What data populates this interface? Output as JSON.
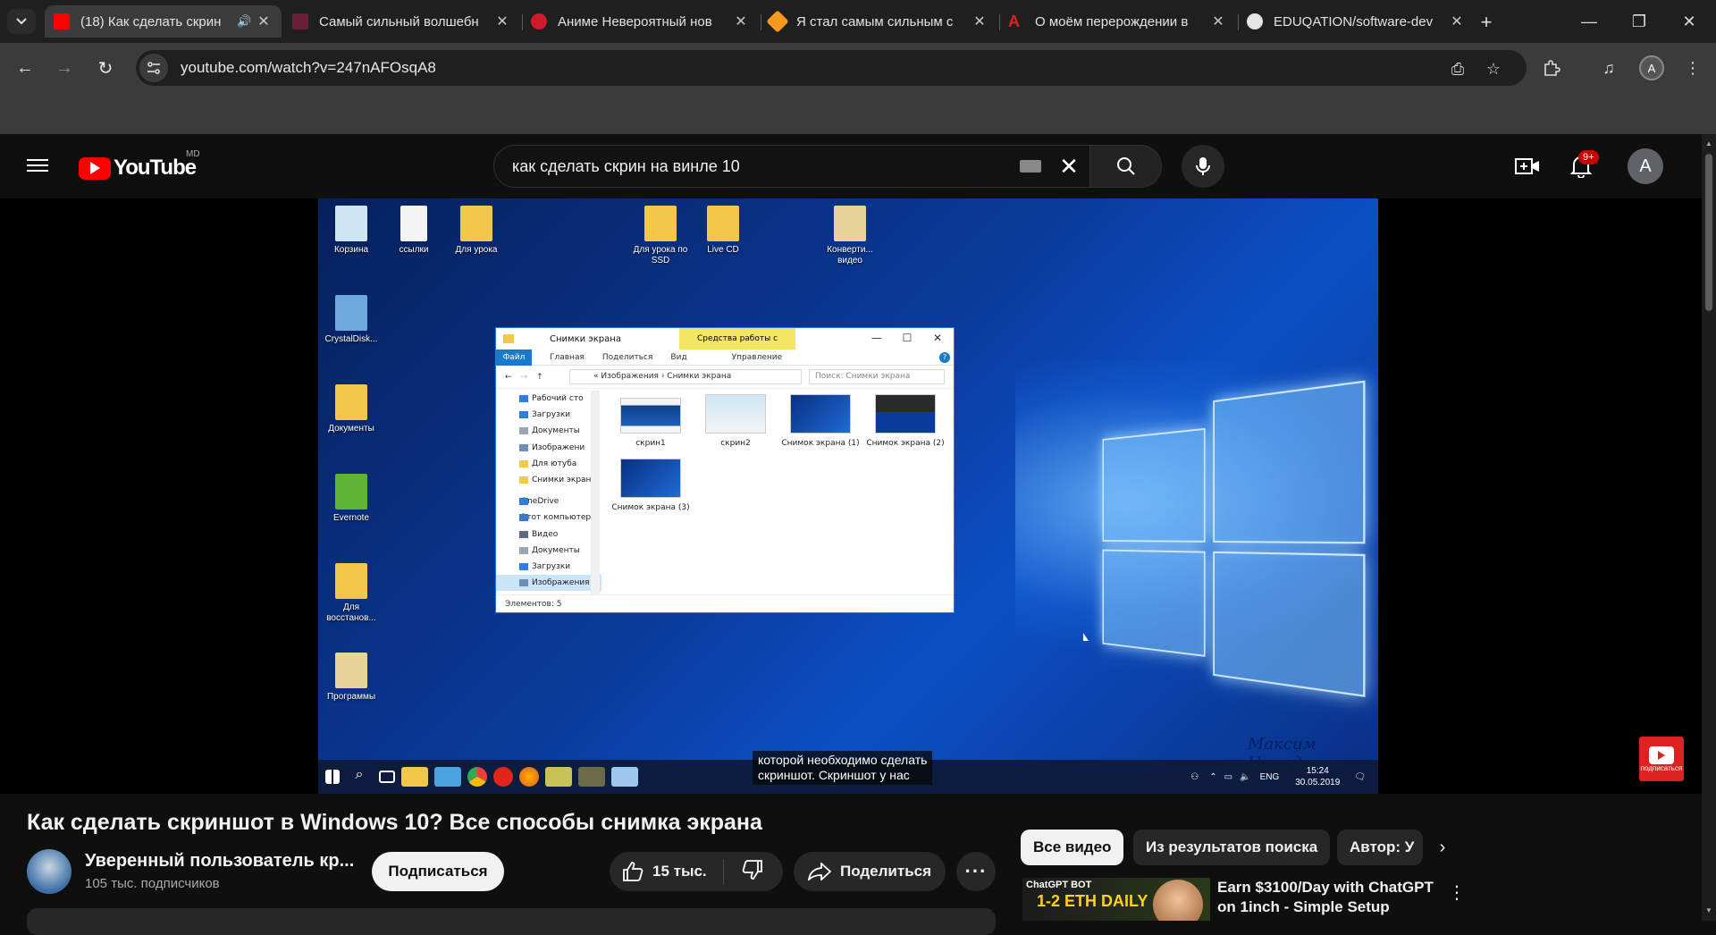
{
  "browser": {
    "tabs": [
      {
        "title": "(18) Как сделать скрин",
        "favicon_color": "#ff0000",
        "active": true,
        "audio": true
      },
      {
        "title": "Самый сильный волшебн",
        "favicon_color": "#6b1f3a",
        "active": false
      },
      {
        "title": "Аниме Невероятный нов",
        "favicon_color": "#d21b2a",
        "active": false
      },
      {
        "title": "Я стал самым сильным с",
        "favicon_color": "#f59a1c",
        "active": false
      },
      {
        "title": "О моём перерождении в",
        "favicon_color": "#e02020",
        "active": false
      },
      {
        "title": "EDUQATION/software-dev",
        "favicon_color": "#e6e6e6",
        "active": false
      }
    ],
    "url": "youtube.com/watch?v=247nAFOsqA8",
    "profile_initial": "A"
  },
  "youtube": {
    "logo_text": "YouTube",
    "country": "MD",
    "search_query": "как сделать скрин на винле 10",
    "notification_count": "9+",
    "avatar_initial": "A"
  },
  "video": {
    "desktop_icons": [
      {
        "label": "Корзина",
        "color": "#cfe6f5"
      },
      {
        "label": "ссылки",
        "color": "#f4f4f4"
      },
      {
        "label": "Для урока",
        "color": "#f2c84b"
      },
      {
        "label": "Для урока по SSD",
        "color": "#f2c84b"
      },
      {
        "label": "Live CD",
        "color": "#f2c84b"
      },
      {
        "label": "Конверти... видео",
        "color": "#e8d49a"
      },
      {
        "label": "CrystalDisk...",
        "color": "#6fa8dc"
      },
      {
        "label": "Документы",
        "color": "#f2c84b"
      },
      {
        "label": "Evernote",
        "color": "#5fb336"
      },
      {
        "label": "Для восстанов...",
        "color": "#f2c84b"
      },
      {
        "label": "Программы",
        "color": "#e8d49a"
      }
    ],
    "explorer": {
      "title": "Снимки экрана",
      "tools_tab": "Средства работы с рисунками",
      "ribbon": [
        "Файл",
        "Главная",
        "Поделиться",
        "Вид",
        "Управление"
      ],
      "path": "« Изображения › Снимки экрана",
      "search_placeholder": "Поиск: Снимки экрана",
      "nav": [
        {
          "label": "Рабочий сто",
          "color": "#2e7fd9"
        },
        {
          "label": "Загрузки",
          "color": "#2e7fd9"
        },
        {
          "label": "Документы",
          "color": "#9aa6b2"
        },
        {
          "label": "Изображени",
          "color": "#6c8fb3"
        },
        {
          "label": "Для ютуба",
          "color": "#f2c84b"
        },
        {
          "label": "Снимки экрана",
          "color": "#f2c84b"
        },
        {
          "label": "OneDrive",
          "color": "#2e7fd9"
        },
        {
          "label": "Этот компьютер",
          "color": "#3b79c6"
        },
        {
          "label": "Видео",
          "color": "#5b6b7d"
        },
        {
          "label": "Документы",
          "color": "#9aa6b2"
        },
        {
          "label": "Загрузки",
          "color": "#2e7fd9"
        },
        {
          "label": "Изображения",
          "color": "#6c8fb3"
        }
      ],
      "files": [
        "скрин1",
        "скрин2",
        "Снимок экрана (1)",
        "Снимок экрана (2)",
        "Снимок экрана (3)"
      ],
      "status": "Элементов: 5"
    },
    "caption_lines": [
      "которой необходимо сделать",
      "скриншот. Скриншот у нас"
    ],
    "watermark": "Максим Ненадов",
    "tray_lang": "ENG",
    "tray_time": "15:24",
    "tray_date": "30.05.2019",
    "subscribe_badge": "подписаться"
  },
  "meta": {
    "title": "Как сделать скриншот в Windows 10? Все способы снимка экрана",
    "channel_name": "Уверенный пользователь кр...",
    "subscribers": "105 тыс. подписчиков",
    "subscribe_label": "Подписаться",
    "likes": "15 тыс.",
    "share_label": "Поделиться",
    "more_label": "···"
  },
  "sidebar": {
    "chips": [
      "Все видео",
      "Из результатов поиска",
      "Автор: У"
    ],
    "ad": {
      "thumb_line1": "ChatGPT BOT",
      "thumb_line2": "1-2 ETH DAILY",
      "title": "Earn $3100/Day with ChatGPT on 1inch - Simple Setup"
    }
  }
}
